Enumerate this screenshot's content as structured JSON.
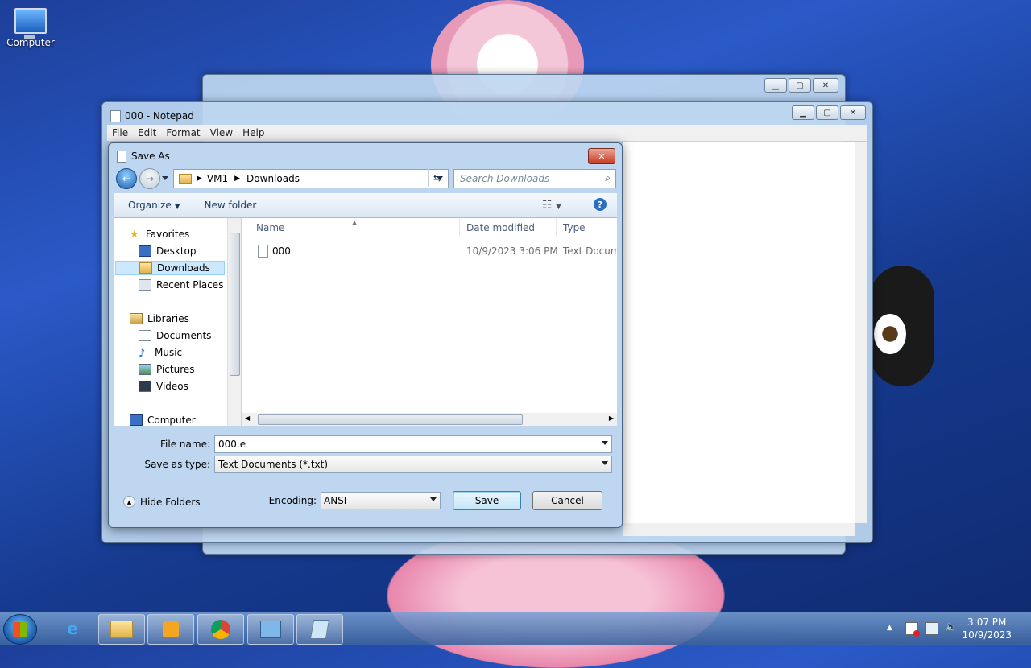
{
  "desktop": {
    "computer_icon_label": "Computer"
  },
  "notepad": {
    "title": "000 - Notepad",
    "menu": [
      "File",
      "Edit",
      "Format",
      "View",
      "Help"
    ]
  },
  "save_as": {
    "title": "Save As",
    "breadcrumb": [
      "VM1",
      "Downloads"
    ],
    "search_placeholder": "Search Downloads",
    "toolbar": {
      "organize": "Organize",
      "new_folder": "New folder"
    },
    "nav_tree": {
      "favorites": "Favorites",
      "favorites_items": [
        "Desktop",
        "Downloads",
        "Recent Places"
      ],
      "libraries": "Libraries",
      "libraries_items": [
        "Documents",
        "Music",
        "Pictures",
        "Videos"
      ],
      "computer": "Computer"
    },
    "columns": {
      "name": "Name",
      "date_modified": "Date modified",
      "type": "Type"
    },
    "files": [
      {
        "name": "000",
        "date_modified": "10/9/2023 3:06 PM",
        "type": "Text Document"
      }
    ],
    "file_name_label": "File name:",
    "file_name_value": "000.e",
    "save_as_type_label": "Save as type:",
    "save_as_type_value": "Text Documents (*.txt)",
    "hide_folders": "Hide Folders",
    "encoding_label": "Encoding:",
    "encoding_value": "ANSI",
    "save_button": "Save",
    "cancel_button": "Cancel"
  },
  "taskbar": {
    "time": "3:07 PM",
    "date": "10/9/2023"
  }
}
